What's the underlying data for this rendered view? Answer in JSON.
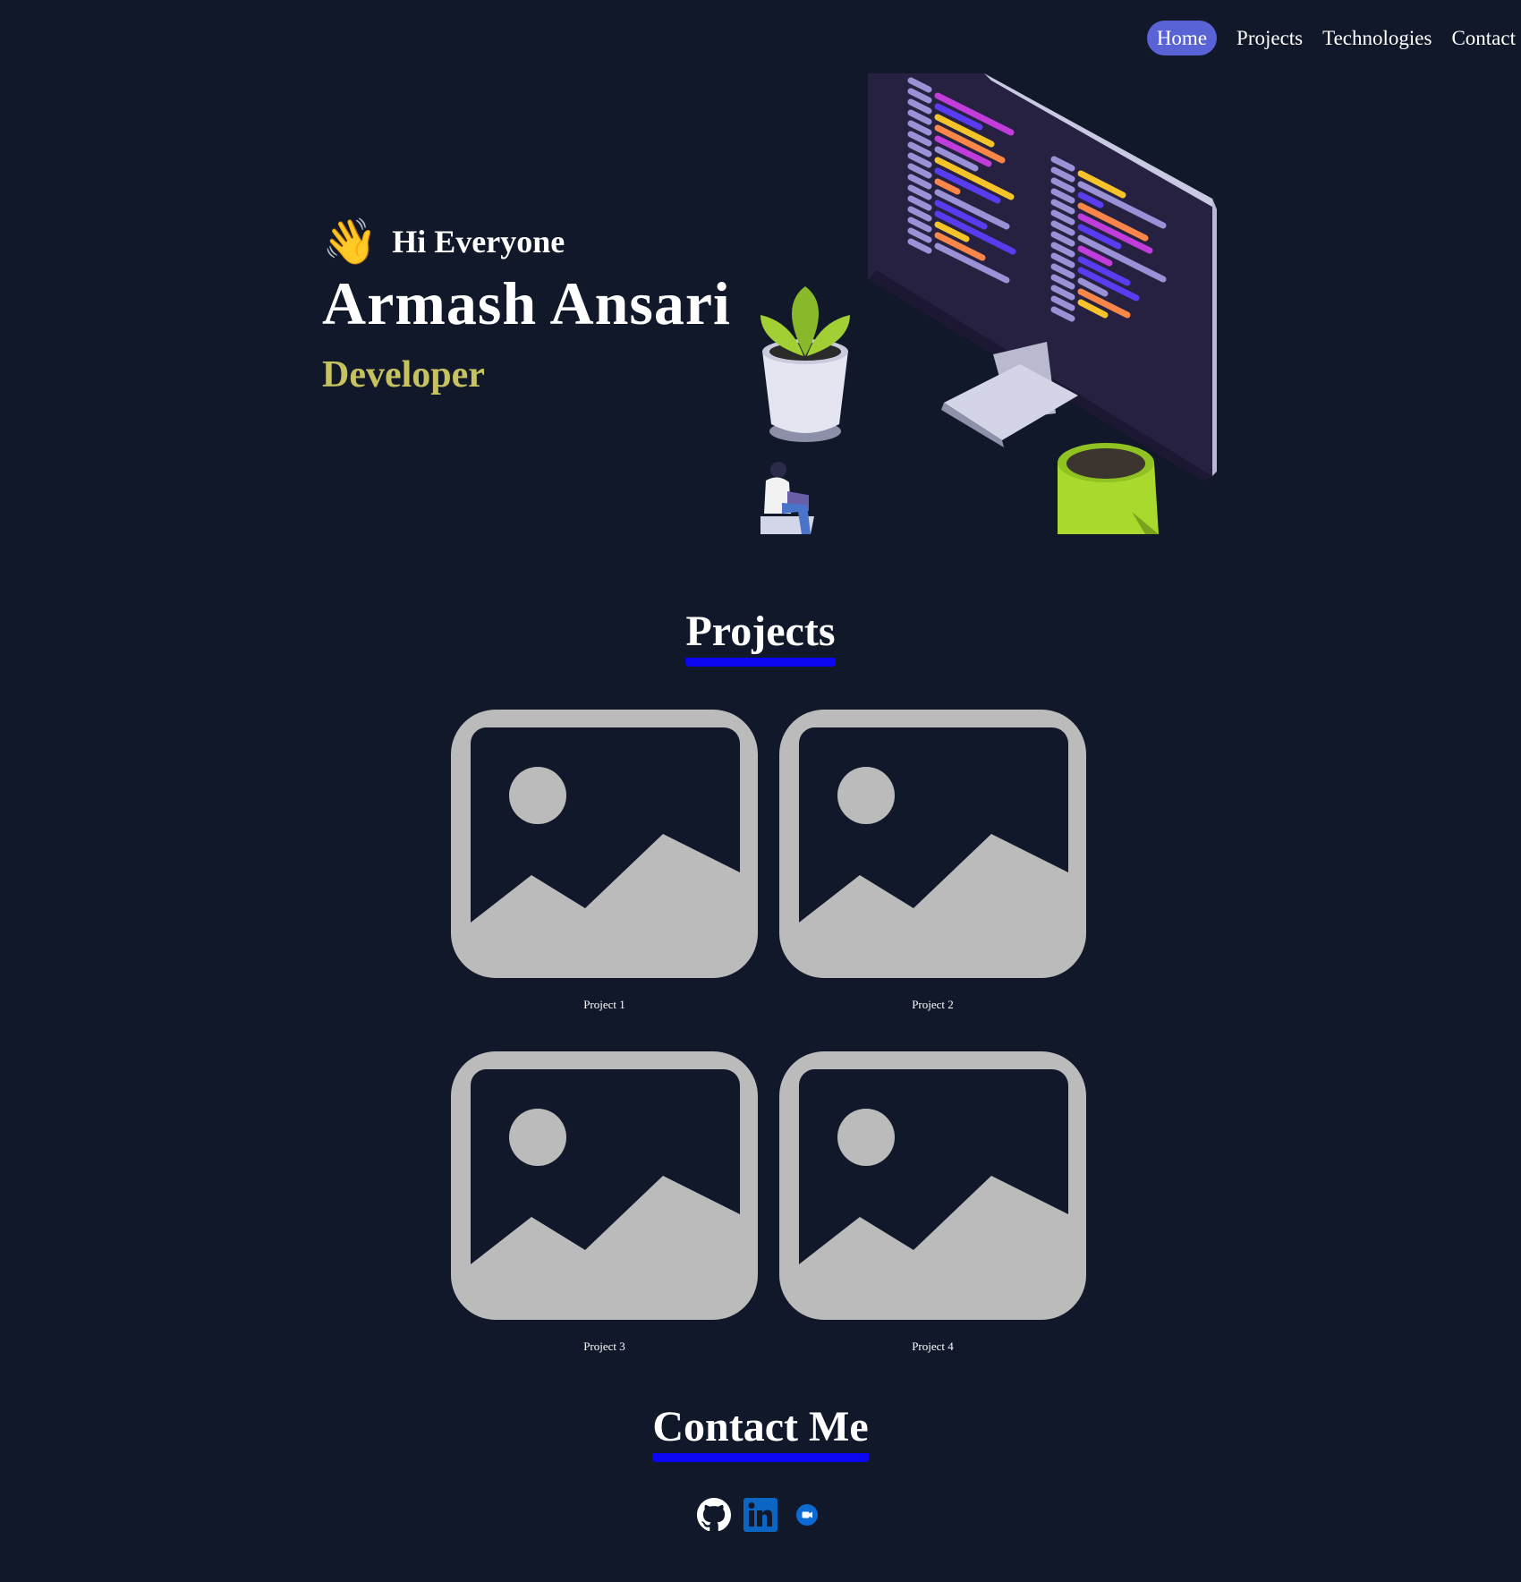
{
  "nav": {
    "items": [
      {
        "label": "Home",
        "active": true
      },
      {
        "label": "Projects",
        "active": false
      },
      {
        "label": "Technologies",
        "active": false
      },
      {
        "label": "Contact",
        "active": false
      }
    ]
  },
  "hero": {
    "wave_icon": "👋",
    "greeting": "Hi Everyone",
    "name": "Armash Ansari",
    "role": "Developer",
    "illustration_icon": "developer-desk-illustration"
  },
  "projects": {
    "title": "Projects",
    "items": [
      {
        "caption": "Project 1",
        "icon": "image-placeholder-icon"
      },
      {
        "caption": "Project 2",
        "icon": "image-placeholder-icon"
      },
      {
        "caption": "Project 3",
        "icon": "image-placeholder-icon"
      },
      {
        "caption": "Project 4",
        "icon": "image-placeholder-icon"
      }
    ]
  },
  "contact": {
    "title": "Contact Me",
    "links": [
      {
        "icon": "github-icon"
      },
      {
        "icon": "linkedin-icon"
      },
      {
        "icon": "video-call-icon"
      }
    ]
  },
  "colors": {
    "background": "#11182a",
    "nav_active": "#5a63d6",
    "role": "#c6c161",
    "underline": "#0a07f0",
    "placeholder": "#bbbbbb"
  }
}
